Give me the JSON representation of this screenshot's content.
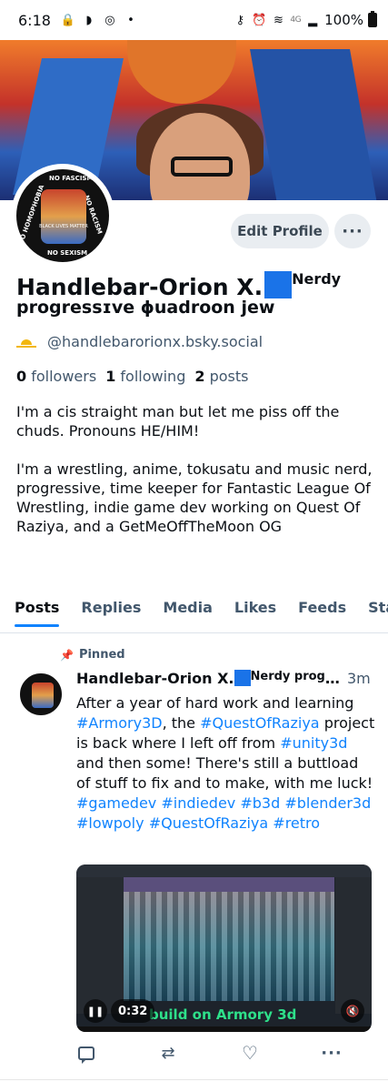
{
  "status_bar": {
    "time": "6:18",
    "network": "4G",
    "battery": "100%",
    "icons": [
      "lock-icon",
      "shield-icon",
      "instagram-icon",
      "dot-icon",
      "key-icon",
      "alarm-icon",
      "wifi-icon",
      "signal-icon",
      "battery-icon"
    ]
  },
  "profile": {
    "edit_profile_label": "Edit Profile",
    "more_label": "···",
    "display_name_main": "Handlebar-Orion X.",
    "display_name_sup": "Nerdy",
    "display_name_line2": "progressɪve ɸuadroon jew",
    "handle": "@handlebarorionx.bsky.social",
    "avatar_text_top": "NO FASCISM",
    "avatar_text_left": "NO HOMOPHOBIA",
    "avatar_text_right": "NO RACISM",
    "avatar_text_bottom": "NO SEXISM",
    "avatar_caption": "BLACK LIVES MATTER",
    "stats": {
      "followers_count": "0",
      "followers_label": "followers",
      "following_count": "1",
      "following_label": "following",
      "posts_count": "2",
      "posts_label": "posts"
    },
    "bio_p1": "I'm a cis straight man but let me piss off the chuds. Pronouns HE/HIM!",
    "bio_p2": "I'm a wrestling, anime, tokusatu and music nerd, progressive, time keeper for Fantastic League Of Wrestling, indie game dev working on Quest Of Raziya, and a GetMeOffTheMoon OG"
  },
  "tabs": [
    {
      "label": "Posts",
      "active": true
    },
    {
      "label": "Replies",
      "active": false
    },
    {
      "label": "Media",
      "active": false
    },
    {
      "label": "Likes",
      "active": false
    },
    {
      "label": "Feeds",
      "active": false
    },
    {
      "label": "Starte",
      "active": false
    }
  ],
  "post": {
    "pinned_label": "Pinned",
    "author_main": "Handlebar-Orion X.",
    "author_rest": "Nerdy progressɪ...",
    "time": "3m",
    "text_1": "After a year of hard work and learning ",
    "tag_1": "#Armory3D",
    "text_2": ", the ",
    "tag_2": "#QuestOfRaziya",
    "text_3": " project is back where I left off from ",
    "tag_3": "#unity3d",
    "text_4": " and then some! There's still a buttload of stuff to fix and to make, with me luck! ",
    "tag_4": "#gamedev",
    "tag_5": "#indiedev",
    "tag_6": "#b3d",
    "tag_7": "#blender3d",
    "tag_8": "#lowpoly",
    "tag_9": "#QuestOfRaziya",
    "tag_10": "#retro",
    "video": {
      "time": "0:32",
      "subtitle": "build on Armory 3d",
      "play_state": "playing"
    }
  },
  "colors": {
    "accent": "#1083fe",
    "muted": "#42576c",
    "badge": "#1a73e8"
  }
}
